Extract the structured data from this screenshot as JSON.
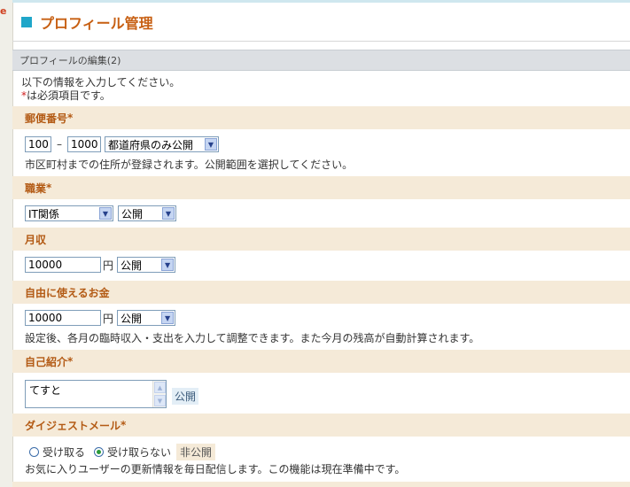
{
  "page": {
    "title": "プロフィール管理",
    "section": "プロフィールの編集(2)",
    "intro_line1": "以下の情報を入力してください。",
    "required_mark": "*",
    "intro_line2": "は必須項目です。"
  },
  "postal": {
    "label": "郵便番号",
    "req": "*",
    "part1": "100",
    "separator": "–",
    "part2": "1000",
    "visibility": "都道府県のみ公開",
    "note": "市区町村までの住所が登録されます。公開範囲を選択してください。"
  },
  "job": {
    "label": "職業",
    "req": "*",
    "value": "IT関係",
    "visibility": "公開"
  },
  "income": {
    "label": "月収",
    "value": "10000",
    "unit": "円",
    "visibility": "公開"
  },
  "spending": {
    "label": "自由に使えるお金",
    "value": "10000",
    "unit": "円",
    "visibility": "公開",
    "note": "設定後、各月の臨時収入・支出を入力して調整できます。また今月の残高が自動計算されます。"
  },
  "intro_self": {
    "label": "自己紹介",
    "req": "*",
    "value": "てすと",
    "visibility": "公開"
  },
  "digest": {
    "label": "ダイジェストメール",
    "req": "*",
    "option_receive": "受け取る",
    "option_not_receive": "受け取らない",
    "selected": "受け取らない",
    "visibility": "非公開",
    "note": "お気に入りユーザーの更新情報を毎日配信します。この機能は現在準備中です。"
  },
  "icons": {
    "select_arrow": "chevron-down-icon",
    "title_marker": "square-bullet-icon"
  },
  "colors": {
    "accent": "#1fa6c9",
    "title": "#c75f12",
    "field_label": "#b35a14",
    "field_bar": "#f5ead8",
    "required": "#d02020"
  }
}
